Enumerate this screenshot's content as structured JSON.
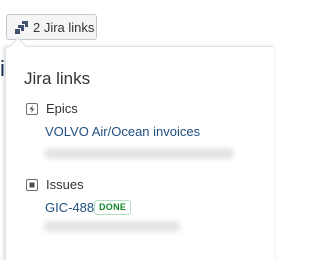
{
  "button": {
    "label": "2 Jira links",
    "icon": "jira-link-icon"
  },
  "background": {
    "fragment": "i"
  },
  "popup": {
    "title": "Jira links",
    "epics": {
      "heading": "Epics",
      "icon": "epic-lightning-icon",
      "items": [
        {
          "label": "VOLVO Air/Ocean invoices"
        }
      ]
    },
    "issues": {
      "heading": "Issues",
      "icon": "issue-checkbox-icon",
      "items": [
        {
          "key": "GIC-488",
          "status": "DONE"
        }
      ]
    }
  },
  "colors": {
    "link": "#205081",
    "done_status": "#14892c",
    "border": "#dfe1e6"
  }
}
